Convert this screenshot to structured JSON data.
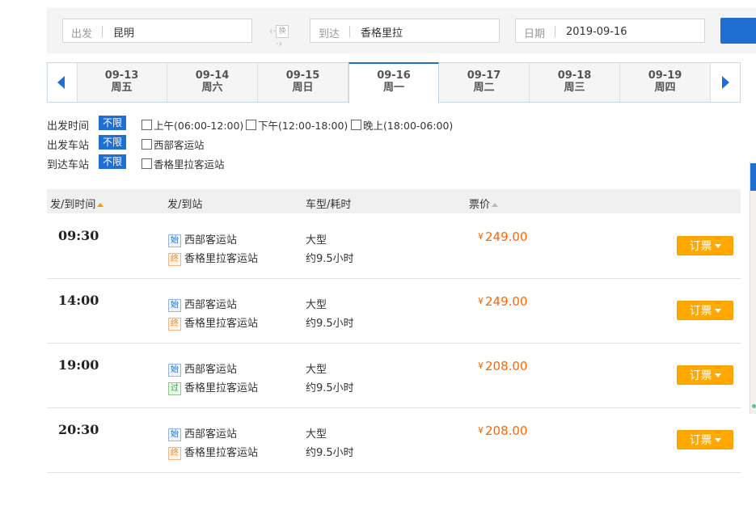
{
  "search": {
    "from_label": "出发",
    "from_value": "昆明",
    "swap_label": "换",
    "to_label": "到达",
    "to_value": "香格里拉",
    "date_label": "日期",
    "date_value": "2019-09-16"
  },
  "date_tabs": [
    {
      "date": "09-13",
      "weekday": "周五",
      "active": false
    },
    {
      "date": "09-14",
      "weekday": "周六",
      "active": false
    },
    {
      "date": "09-15",
      "weekday": "周日",
      "active": false
    },
    {
      "date": "09-16",
      "weekday": "周一",
      "active": true
    },
    {
      "date": "09-17",
      "weekday": "周二",
      "active": false
    },
    {
      "date": "09-18",
      "weekday": "周三",
      "active": false
    },
    {
      "date": "09-19",
      "weekday": "周四",
      "active": false
    }
  ],
  "filters": {
    "no_limit": "不限",
    "depart_time": {
      "label": "出发时间",
      "options": [
        "上午(06:00-12:00)",
        "下午(12:00-18:00)",
        "晚上(18:00-06:00)"
      ]
    },
    "depart_station": {
      "label": "出发车站",
      "options": [
        "西部客运站"
      ]
    },
    "arrive_station": {
      "label": "到达车站",
      "options": [
        "香格里拉客运站"
      ]
    }
  },
  "table": {
    "headers": {
      "time": "发/到时间",
      "station": "发/到站",
      "bus": "车型/耗时",
      "price": "票价"
    },
    "rows": [
      {
        "time": "09:30",
        "from_tag": "始",
        "from": "西部客运站",
        "to_tag": "终",
        "to": "香格里拉客运站",
        "bus_type": "大型",
        "duration": "约9.5小时",
        "currency": "¥",
        "price": "249.00",
        "book": "订票"
      },
      {
        "time": "14:00",
        "from_tag": "始",
        "from": "西部客运站",
        "to_tag": "终",
        "to": "香格里拉客运站",
        "bus_type": "大型",
        "duration": "约9.5小时",
        "currency": "¥",
        "price": "249.00",
        "book": "订票"
      },
      {
        "time": "19:00",
        "from_tag": "始",
        "from": "西部客运站",
        "to_tag": "过",
        "to": "香格里拉客运站",
        "bus_type": "大型",
        "duration": "约9.5小时",
        "currency": "¥",
        "price": "208.00",
        "book": "订票"
      },
      {
        "time": "20:30",
        "from_tag": "始",
        "from": "西部客运站",
        "to_tag": "终",
        "to": "香格里拉客运站",
        "bus_type": "大型",
        "duration": "约9.5小时",
        "currency": "¥",
        "price": "208.00",
        "book": "订票"
      }
    ]
  },
  "colors": {
    "accent": "#1e6fd1",
    "price": "#ff6600",
    "book_button": "#ffa800"
  }
}
